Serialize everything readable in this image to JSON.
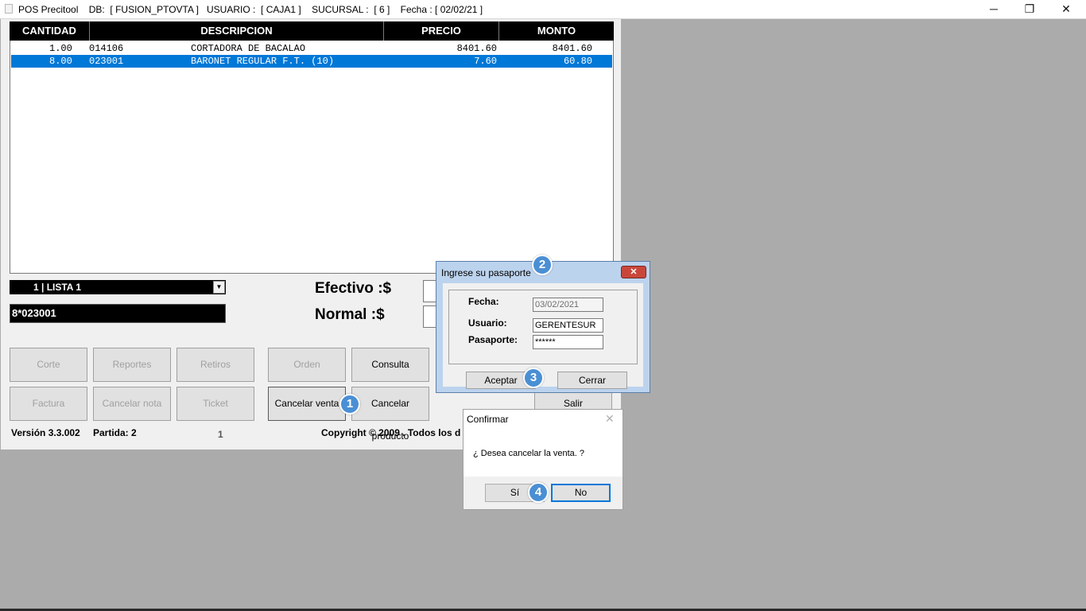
{
  "titlebar": {
    "app_name": "POS Precitool",
    "db_label": "DB:",
    "db_value": "[ FUSION_PTOVTA ]",
    "usuario_label": "USUARIO :",
    "usuario_value": "[ CAJA1 ]",
    "sucursal_label": "SUCURSAL :",
    "sucursal_value": "[ 6 ]",
    "fecha_label": "Fecha :",
    "fecha_value": "[ 02/02/21 ]",
    "minimize": "─",
    "restore": "❐",
    "close": "✕"
  },
  "grid": {
    "columns": [
      "CANTIDAD",
      "DESCRIPCION",
      "PRECIO",
      "MONTO"
    ],
    "rows": [
      {
        "cantidad": "1.00",
        "codigo": "014106",
        "descripcion": "CORTADORA DE BACALAO",
        "precio": "8401.60",
        "monto": "8401.60",
        "selected": false
      },
      {
        "cantidad": "8.00",
        "codigo": "023001",
        "descripcion": "BARONET REGULAR F.T. (10)",
        "precio": "7.60",
        "monto": "60.80",
        "selected": true
      }
    ]
  },
  "price_list": {
    "value": "1  | LISTA 1"
  },
  "scan_input": {
    "value": "8*023001"
  },
  "totals": {
    "efectivo_label": "Efectivo :$",
    "normal_label": "Normal  :$"
  },
  "buttons": {
    "corte": "Corte",
    "reportes": "Reportes",
    "retiros": "Retiros",
    "orden": "Orden",
    "consulta": "Consulta",
    "factura": "Factura",
    "cancelar_nota": "Cancelar nota",
    "ticket": "Ticket",
    "cancelar_venta": "Cancelar venta",
    "cancelar_producto": "Cancelar producto",
    "salir": "Salir"
  },
  "footer": {
    "version": "Versión 3.3.002",
    "partida": "Partida: 2",
    "page": "1",
    "copyright": "Copyright © 2009 . Todos los d"
  },
  "steps": [
    "1",
    "2",
    "3",
    "4"
  ],
  "passport_dialog": {
    "title": "Ingrese su pasaporte",
    "close": "✕",
    "fecha_label": "Fecha:",
    "fecha_value": "03/02/2021",
    "usuario_label": "Usuario:",
    "usuario_value": "GERENTESUR",
    "pasaporte_label": "Pasaporte:",
    "pasaporte_value": "******",
    "aceptar": "Aceptar",
    "cerrar": "Cerrar"
  },
  "confirm_dialog": {
    "title": "Confirmar",
    "close": "✕",
    "message": "¿ Desea cancelar la venta. ?",
    "yes": "Sí",
    "no": "No"
  },
  "colors": {
    "selection": "#0078d7",
    "badge": "#4a8fd4",
    "desktop": "#ababab",
    "dialog_frame": "#bcd3ee"
  }
}
